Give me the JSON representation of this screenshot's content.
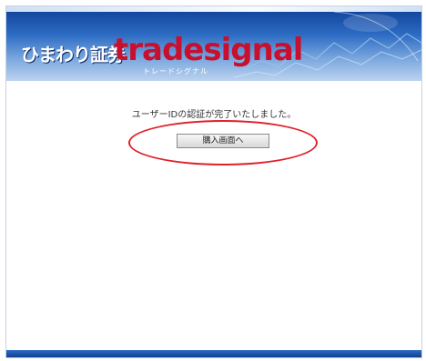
{
  "header": {
    "logo_jp": "ひまわり証券",
    "logo_brand_pre": "trade",
    "logo_brand_s": "s",
    "logo_brand_post": "ignal",
    "logo_kana": "トレードシグナル"
  },
  "main": {
    "message": "ユーザーIDの認証が完了いたしました。",
    "button_label": "購入画面へ"
  },
  "colors": {
    "banner_dark": "#0e3e96",
    "brand_red": "#c8102e",
    "highlight_red": "#e0202a"
  }
}
